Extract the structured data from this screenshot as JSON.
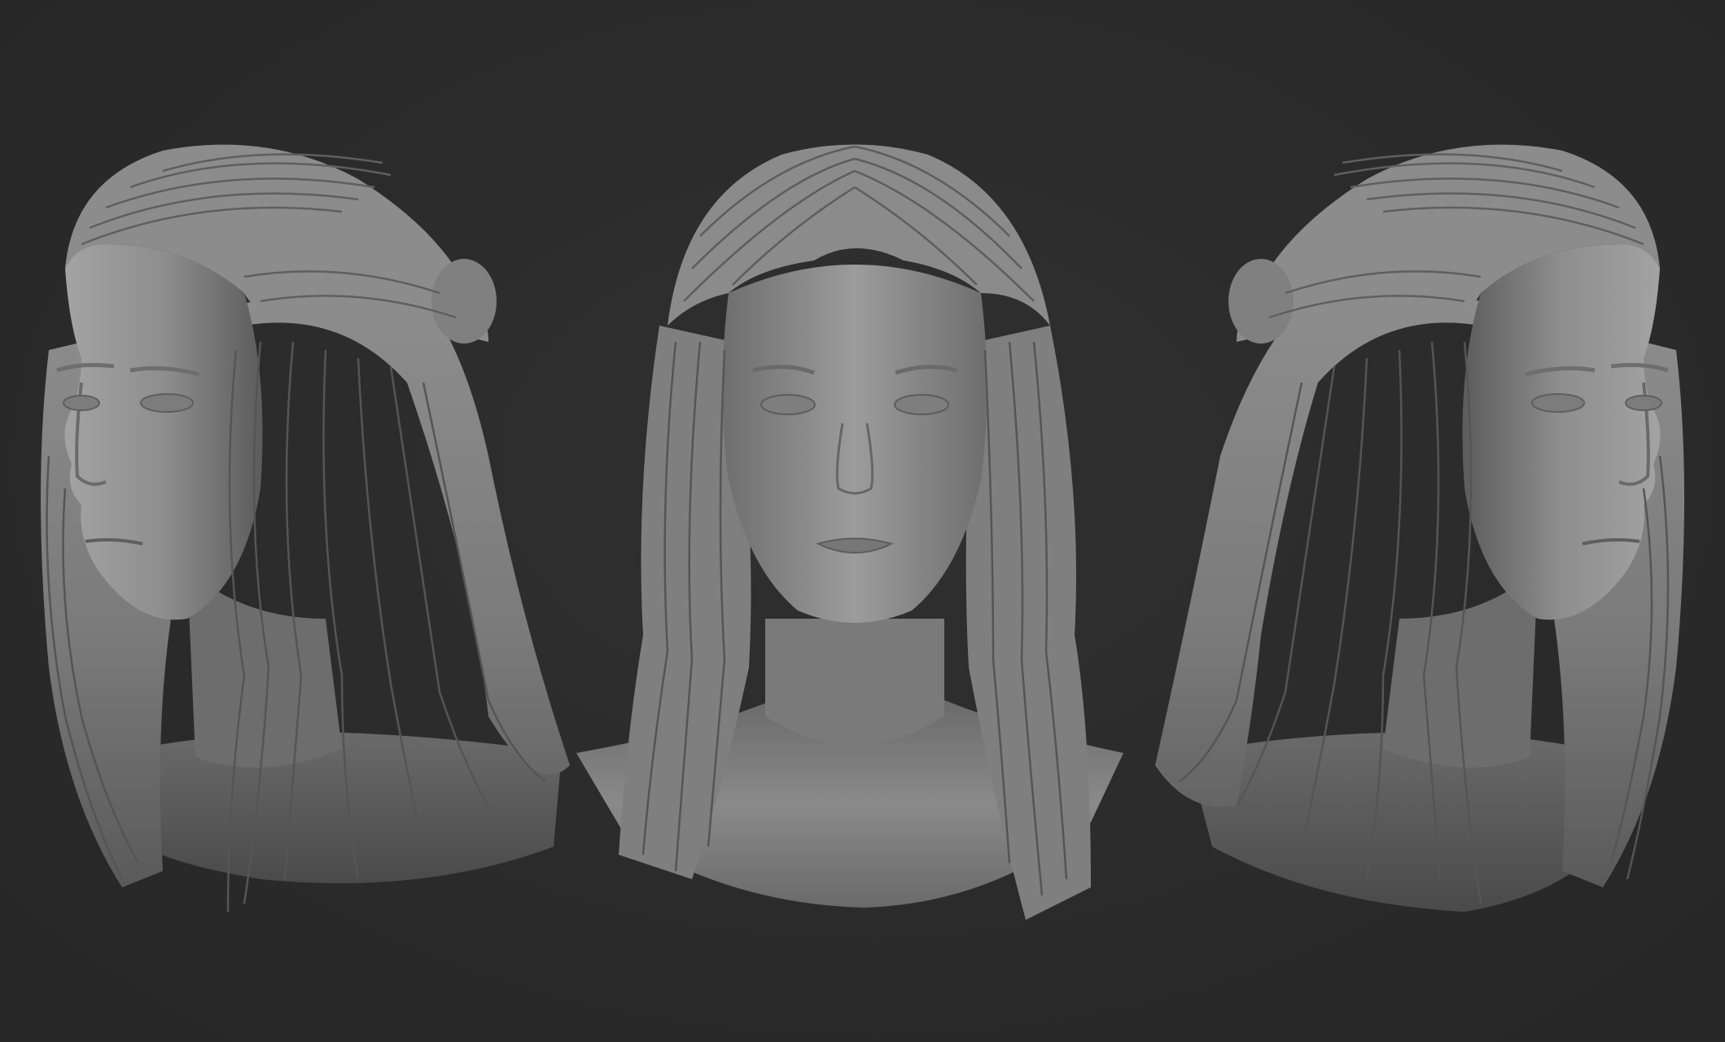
{
  "scene": {
    "background_color": "#2b2b2b",
    "material_color": "#8a8a8a",
    "views": [
      {
        "id": "left",
        "description_name": "three-quarter-left"
      },
      {
        "id": "front",
        "description_name": "front"
      },
      {
        "id": "right",
        "description_name": "three-quarter-right"
      }
    ]
  }
}
